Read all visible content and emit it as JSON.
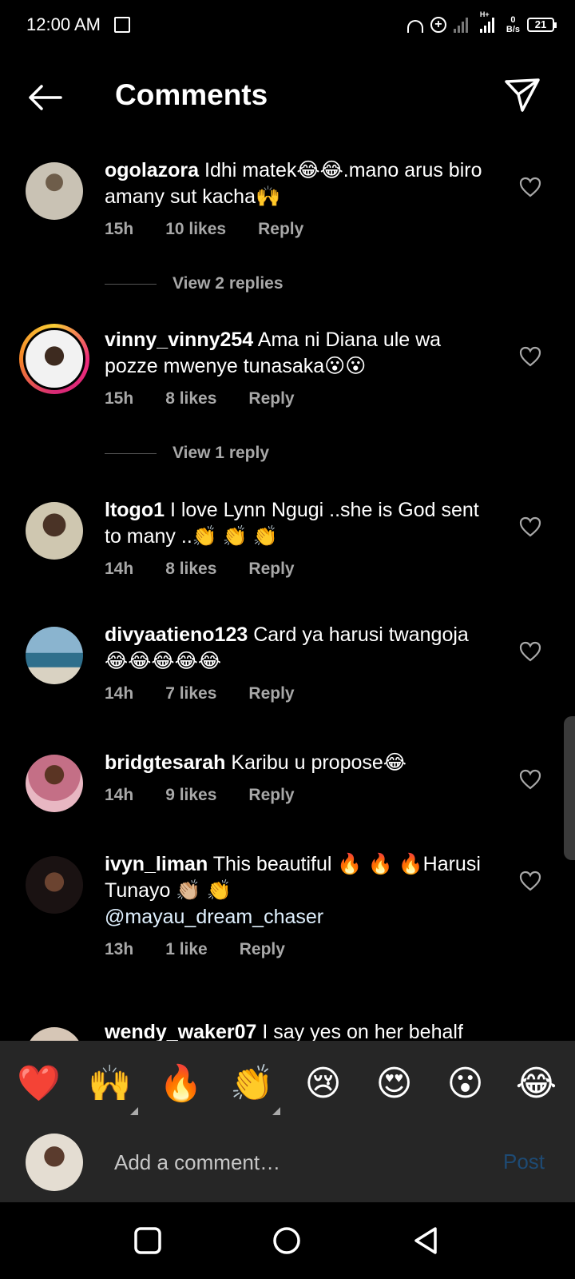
{
  "status_bar": {
    "time": "12:00 AM",
    "net_speed_top": "0",
    "net_speed_bottom": "B/s",
    "battery": "21",
    "network_label": "H+"
  },
  "header": {
    "title": "Comments"
  },
  "comments": [
    {
      "username": "ogolazora",
      "text": "Idhi matek😂😂.mano arus biro amany sut kacha🙌",
      "time": "15h",
      "likes": "10 likes",
      "reply_label": "Reply",
      "view_replies": "View 2 replies"
    },
    {
      "username": "vinny_vinny254",
      "text": "Ama ni Diana ule wa pozze mwenye tunasaka😮😮",
      "time": "15h",
      "likes": "8 likes",
      "reply_label": "Reply",
      "view_replies": "View 1 reply"
    },
    {
      "username": "ltogo1",
      "text": "I love Lynn Ngugi ..she is God sent to many ..👏 👏 👏",
      "time": "14h",
      "likes": "8 likes",
      "reply_label": "Reply"
    },
    {
      "username": "divyaatieno123",
      "text": "Card ya harusi twangoja 😂😂😂😂😂",
      "time": "14h",
      "likes": "7 likes",
      "reply_label": "Reply"
    },
    {
      "username": "bridgtesarah",
      "text": "Karibu u propose😂",
      "time": "14h",
      "likes": "9 likes",
      "reply_label": "Reply"
    },
    {
      "username": "ivyn_liman",
      "text": "This beautiful 🔥 🔥 🔥Harusi Tunayo 👏🏼 👏",
      "mention": "@mayau_dream_chaser",
      "time": "13h",
      "likes": "1 like",
      "reply_label": "Reply"
    },
    {
      "username": "wendy_waker07",
      "text": "I say yes on her behalf"
    }
  ],
  "emoji_bar": [
    "❤️",
    "🙌",
    "🔥",
    "👏",
    "😢",
    "😍",
    "😮",
    "😂"
  ],
  "compose": {
    "placeholder": "Add a comment…",
    "post_label": "Post"
  },
  "colors": {
    "background": "#000000",
    "panel": "#262626",
    "muted_text": "#a8a8a8",
    "post_disabled": "#1e4a73"
  }
}
